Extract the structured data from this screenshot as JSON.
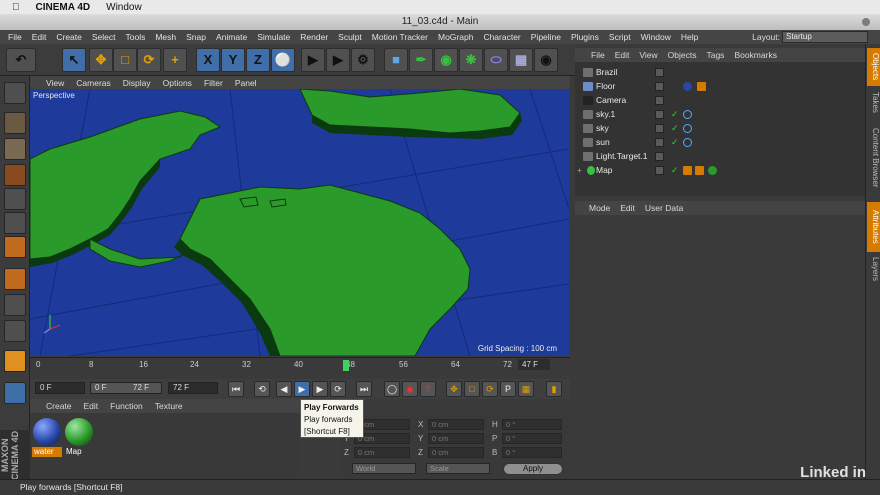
{
  "mac_menubar": {
    "app": "CINEMA 4D",
    "window": "Window"
  },
  "window_title": "11_03.c4d - Main",
  "menu": [
    "File",
    "Edit",
    "Create",
    "Select",
    "Tools",
    "Mesh",
    "Snap",
    "Animate",
    "Simulate",
    "Render",
    "Sculpt",
    "Motion Tracker",
    "MoGraph",
    "Character",
    "Pipeline",
    "Plugins",
    "Script",
    "Window",
    "Help"
  ],
  "layout": {
    "label": "Layout:",
    "value": "Startup"
  },
  "toolbar_axes": [
    "X",
    "Y",
    "Z"
  ],
  "viewport": {
    "menu": [
      "View",
      "Cameras",
      "Display",
      "Options",
      "Filter",
      "Panel"
    ],
    "label": "Perspective",
    "grid_spacing": "Grid Spacing : 100 cm"
  },
  "timeline": {
    "ticks": [
      "0",
      "8",
      "16",
      "24",
      "32",
      "40",
      "48",
      "56",
      "64",
      "72"
    ],
    "end_frame": "47 F",
    "current_frame": 46
  },
  "transport": {
    "start": "0 F",
    "range_start": "0 F",
    "range_end": "72 F",
    "end": "72 F"
  },
  "tooltip": {
    "title": "Play Forwards",
    "desc": "Play forwards",
    "shortcut": "[Shortcut F8]"
  },
  "materials": {
    "menu": [
      "Create",
      "Edit",
      "Function",
      "Texture"
    ],
    "items": [
      {
        "name": "water",
        "color": "#2848a8"
      },
      {
        "name": "Map",
        "color": "#2a9a2a"
      }
    ]
  },
  "coordinates": {
    "rows": [
      {
        "a": "X",
        "av": "0 cm",
        "b": "X",
        "bv": "0 cm",
        "c": "H",
        "cv": "0 °"
      },
      {
        "a": "Y",
        "av": "0 cm",
        "b": "Y",
        "bv": "0 cm",
        "c": "P",
        "cv": "0 °"
      },
      {
        "a": "Z",
        "av": "0 cm",
        "b": "Z",
        "bv": "0 cm",
        "c": "B",
        "cv": "0 °"
      }
    ],
    "world": "World",
    "scale": "Scale",
    "apply": "Apply"
  },
  "brand": "MAXON CINEMA 4D",
  "objects": {
    "menu": [
      "File",
      "Edit",
      "View",
      "Objects",
      "Tags",
      "Bookmarks"
    ],
    "items": [
      "Brazil",
      "Floor",
      "Camera",
      "sky.1",
      "sky",
      "sun",
      "Light.Target.1",
      "Map"
    ]
  },
  "attributes": {
    "menu": [
      "Mode",
      "Edit",
      "User Data"
    ]
  },
  "side_tabs": [
    "Objects",
    "Takes",
    "Content Browser",
    "Attributes",
    "Layers"
  ],
  "status": "Play forwards [Shortcut F8]",
  "watermark": "Linked in",
  "colors": {
    "land": "#2a9a2a",
    "sea": "#1e3a9a",
    "accent": "#d47b00"
  }
}
